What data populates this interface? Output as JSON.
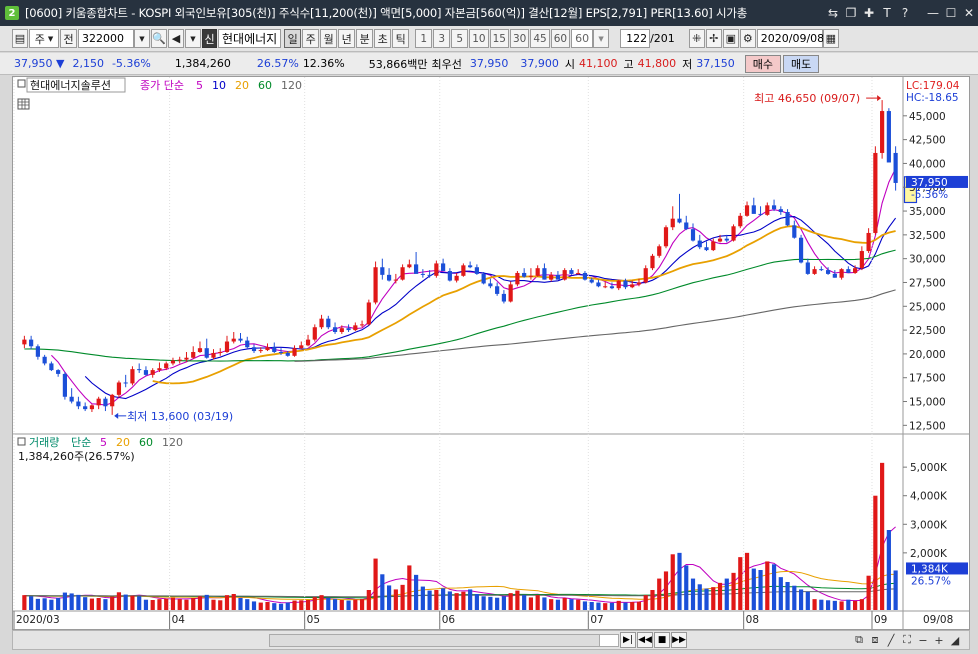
{
  "window": {
    "app_badge": "2",
    "title": "[0600] 키움종합차트 - KOSPI 외국인보유[305(천)] 주식수[11,200(천)] 액면[5,000] 자본금[560(억)] 결산[12월] EPS[2,791] PER[13.60] 시가총"
  },
  "toolbar": {
    "market": "주",
    "prev": "전",
    "code": "322000",
    "new_badge": "신",
    "stock_name": "현대에너지",
    "periods": [
      "일",
      "주",
      "월",
      "년",
      "분",
      "초",
      "틱"
    ],
    "active_period": "일",
    "intervals": [
      "1",
      "3",
      "5",
      "10",
      "15",
      "30",
      "45",
      "60"
    ],
    "interval_value": "60",
    "count": "122",
    "count_total": "/201",
    "date": "2020/09/08"
  },
  "quote": {
    "price": "37,950 ▼",
    "change": "2,150",
    "change_pct": "-5.36%",
    "volume": "1,384,260",
    "volume_ratio": "26.57%",
    "turnover": "12.36%",
    "amount": "53,866백만",
    "best_ask_label": "최우선",
    "best_ask": "37,950",
    "best_bid": "37,900",
    "open_label": "시",
    "open": "41,100",
    "high_label": "고",
    "high": "41,800",
    "low_label": "저",
    "low": "37,150",
    "buy": "매수",
    "sell": "매도"
  },
  "price_pane": {
    "stock_label": "현대에너지솔루션",
    "legend_label": "종가 단순",
    "ma": [
      {
        "period": "5",
        "color": "#c000c0"
      },
      {
        "period": "10",
        "color": "#0000c8"
      },
      {
        "period": "20",
        "color": "#e8a000"
      },
      {
        "period": "60",
        "color": "#008a2a"
      },
      {
        "period": "120",
        "color": "#666666"
      }
    ],
    "lc": "LC:179.04",
    "hc": "HC:-18.65",
    "y_ticks": [
      "45,000",
      "42,500",
      "40,000",
      "37,500",
      "35,000",
      "32,500",
      "30,000",
      "27,500",
      "25,000",
      "22,500",
      "20,000",
      "17,500",
      "15,000",
      "12,500"
    ],
    "current_price": "37,950",
    "current_pct": "-5.36%",
    "high_note": "최고 46,650 (09/07)",
    "low_note": "최저 13,600 (03/19)"
  },
  "volume_pane": {
    "legend_label": "거래량",
    "legend_sub": "단순",
    "ma": [
      {
        "period": "5",
        "color": "#c000c0"
      },
      {
        "period": "20",
        "color": "#e8a000"
      },
      {
        "period": "60",
        "color": "#008a2a"
      },
      {
        "period": "120",
        "color": "#666666"
      }
    ],
    "current_volume": "1,384,260주(26.57%)",
    "y_ticks": [
      "5,000K",
      "4,000K",
      "3,000K",
      "2,000K"
    ],
    "current_badge": "1,384K",
    "current_pct": "26.57%"
  },
  "x_axis": {
    "labels": [
      "2020/03",
      "04",
      "05",
      "06",
      "07",
      "08",
      "09"
    ],
    "right_label": "09/08"
  },
  "colors": {
    "up": "#e01818",
    "down": "#1b4fd8"
  },
  "chart_data": {
    "type": "candlestick",
    "x": [
      "03/02",
      "03/03",
      "03/04",
      "03/05",
      "03/06",
      "03/09",
      "03/10",
      "03/11",
      "03/12",
      "03/13",
      "03/16",
      "03/17",
      "03/18",
      "03/19",
      "03/20",
      "03/23",
      "03/24",
      "03/25",
      "03/26",
      "03/27",
      "03/30",
      "03/31",
      "04/01",
      "04/02",
      "04/03",
      "04/06",
      "04/07",
      "04/08",
      "04/09",
      "04/10",
      "04/13",
      "04/14",
      "04/16",
      "04/17",
      "04/20",
      "04/21",
      "04/22",
      "04/23",
      "04/24",
      "04/27",
      "04/28",
      "04/29",
      "05/04",
      "05/06",
      "05/07",
      "05/08",
      "05/11",
      "05/12",
      "05/13",
      "05/14",
      "05/15",
      "05/18",
      "05/19",
      "05/20",
      "05/21",
      "05/22",
      "05/25",
      "05/26",
      "05/27",
      "05/28",
      "05/29",
      "06/01",
      "06/02",
      "06/03",
      "06/04",
      "06/05",
      "06/08",
      "06/09",
      "06/10",
      "06/11",
      "06/12",
      "06/15",
      "06/16",
      "06/17",
      "06/18",
      "06/19",
      "06/22",
      "06/23",
      "06/24",
      "06/25",
      "06/26",
      "06/29",
      "06/30",
      "07/01",
      "07/02",
      "07/03",
      "07/06",
      "07/07",
      "07/08",
      "07/09",
      "07/10",
      "07/13",
      "07/14",
      "07/15",
      "07/16",
      "07/17",
      "07/20",
      "07/21",
      "07/22",
      "07/23",
      "07/24",
      "07/27",
      "07/28",
      "07/29",
      "07/30",
      "07/31",
      "08/03",
      "08/04",
      "08/05",
      "08/06",
      "08/07",
      "08/10",
      "08/11",
      "08/12",
      "08/13",
      "08/14",
      "08/18",
      "08/19",
      "08/20",
      "08/21",
      "08/24",
      "08/25",
      "08/26",
      "08/27",
      "08/28",
      "08/31",
      "09/01",
      "09/02",
      "09/03",
      "09/04",
      "09/07",
      "09/08"
    ],
    "open": [
      21000,
      21500,
      20800,
      19700,
      19000,
      18300,
      17900,
      15500,
      15000,
      14500,
      14200,
      14600,
      15300,
      14500,
      15700,
      17000,
      16900,
      18400,
      18300,
      17800,
      18300,
      18500,
      19000,
      19300,
      19400,
      19600,
      20200,
      20600,
      19600,
      20100,
      20200,
      21300,
      21600,
      21400,
      20700,
      20300,
      20400,
      20700,
      20200,
      20100,
      19800,
      20600,
      20900,
      21500,
      22800,
      23700,
      22800,
      22300,
      22700,
      22500,
      23000,
      23100,
      25400,
      29100,
      28300,
      27700,
      27800,
      29100,
      29400,
      28400,
      28300,
      28200,
      29500,
      28700,
      27700,
      28200,
      29300,
      29100,
      28400,
      27400,
      27100,
      26300,
      25500,
      27300,
      28500,
      28100,
      28200,
      29000,
      27800,
      28300,
      27800,
      28800,
      28400,
      28500,
      27800,
      27500,
      27100,
      27100,
      26900,
      27700,
      27000,
      27300,
      27500,
      29000,
      30300,
      31300,
      33300,
      34200,
      33800,
      33100,
      31900,
      31200,
      30900,
      31800,
      32100,
      31900,
      33400,
      34500,
      35600,
      34700,
      34600,
      35600,
      35200,
      34900,
      33500,
      32200,
      29600,
      28400,
      28900,
      28800,
      28400,
      28000,
      28900,
      28500,
      29000,
      30800,
      32700,
      41100,
      45500,
      41100
    ],
    "high": [
      21900,
      21900,
      21000,
      19900,
      19200,
      18400,
      18100,
      16400,
      15500,
      14900,
      14700,
      15500,
      15500,
      15800,
      17200,
      17800,
      18700,
      19000,
      18700,
      18500,
      19100,
      19200,
      19600,
      19700,
      20200,
      20800,
      21300,
      21600,
      20500,
      20600,
      21900,
      22300,
      22200,
      21800,
      21000,
      20700,
      21100,
      21200,
      20600,
      20300,
      20900,
      21300,
      22000,
      23100,
      24100,
      24000,
      23300,
      23000,
      23100,
      23300,
      23500,
      25700,
      29700,
      30000,
      29000,
      28400,
      29400,
      29900,
      30700,
      28900,
      28800,
      29800,
      30000,
      29000,
      28500,
      29500,
      29700,
      29400,
      28600,
      27900,
      27500,
      26700,
      27600,
      28700,
      29000,
      29000,
      29300,
      29500,
      28600,
      28700,
      29000,
      29000,
      28900,
      28700,
      28000,
      27800,
      27600,
      27500,
      27800,
      27900,
      27700,
      27900,
      29300,
      30500,
      31500,
      33500,
      35500,
      36800,
      34500,
      33700,
      32500,
      31800,
      32100,
      32500,
      32500,
      33600,
      34800,
      36000,
      36400,
      35500,
      35900,
      36200,
      35500,
      35200,
      34000,
      32500,
      30000,
      29200,
      29200,
      29100,
      28800,
      29000,
      29200,
      29300,
      31300,
      33200,
      41800,
      46650,
      45800,
      41800
    ],
    "low": [
      20600,
      20500,
      19400,
      18800,
      18200,
      17600,
      15200,
      14800,
      14200,
      14000,
      13900,
      14200,
      14000,
      13600,
      15400,
      16500,
      16700,
      18000,
      17700,
      17500,
      18100,
      18300,
      18800,
      19000,
      19200,
      19500,
      20100,
      19500,
      19400,
      19800,
      20100,
      21100,
      21200,
      20600,
      20100,
      20100,
      20300,
      20100,
      19900,
      19700,
      19700,
      20500,
      20800,
      21300,
      22600,
      22600,
      22100,
      22100,
      22300,
      22400,
      22800,
      23000,
      25200,
      27800,
      27600,
      27400,
      27700,
      29000,
      28500,
      28000,
      28000,
      28000,
      28700,
      27600,
      27500,
      28100,
      29000,
      28300,
      27300,
      26900,
      26100,
      25300,
      25400,
      27100,
      28000,
      27800,
      28100,
      27800,
      27600,
      27800,
      27700,
      28300,
      28300,
      27700,
      27400,
      27000,
      26900,
      26800,
      26700,
      26800,
      26900,
      27100,
      27400,
      28800,
      30100,
      31100,
      33000,
      33700,
      33000,
      31800,
      31000,
      30800,
      30800,
      31700,
      31700,
      31800,
      33200,
      34400,
      34800,
      34500,
      34500,
      35000,
      34600,
      33400,
      32100,
      29500,
      28300,
      28300,
      28700,
      28300,
      28000,
      27800,
      28700,
      28400,
      28800,
      30600,
      32500,
      40500,
      41000,
      37150
    ],
    "close": [
      21500,
      20800,
      19700,
      19000,
      18300,
      17900,
      15500,
      15000,
      14500,
      14200,
      14600,
      15300,
      14500,
      15700,
      17000,
      16900,
      18400,
      18300,
      17800,
      18300,
      18500,
      19000,
      19300,
      19400,
      19600,
      20200,
      20600,
      19600,
      20100,
      20200,
      21300,
      21600,
      21400,
      20700,
      20300,
      20400,
      20700,
      20200,
      20100,
      19800,
      20600,
      20900,
      21500,
      22800,
      23700,
      22800,
      22300,
      22700,
      22500,
      23000,
      23100,
      25400,
      29100,
      28300,
      27700,
      27800,
      29100,
      29400,
      28400,
      28300,
      28200,
      29500,
      28700,
      27700,
      28200,
      29300,
      29100,
      28400,
      27400,
      27100,
      26300,
      25500,
      27300,
      28500,
      28100,
      28200,
      29000,
      27800,
      28300,
      27800,
      28800,
      28400,
      28500,
      27800,
      27500,
      27100,
      27100,
      26900,
      27700,
      27000,
      27300,
      27500,
      29000,
      30300,
      31300,
      33300,
      34200,
      33800,
      33100,
      31900,
      31200,
      30900,
      31800,
      32100,
      31900,
      33400,
      34500,
      35600,
      34700,
      34600,
      35600,
      35200,
      34900,
      33500,
      32200,
      29600,
      28400,
      28900,
      28800,
      28400,
      28000,
      28900,
      28500,
      29000,
      30800,
      32700,
      41100,
      45500,
      40100,
      37950
    ],
    "volume": [
      520,
      480,
      390,
      410,
      360,
      420,
      610,
      580,
      530,
      450,
      400,
      420,
      380,
      470,
      620,
      540,
      500,
      480,
      360,
      350,
      380,
      400,
      430,
      380,
      360,
      420,
      480,
      530,
      360,
      340,
      520,
      560,
      420,
      380,
      300,
      260,
      280,
      240,
      220,
      260,
      330,
      340,
      350,
      450,
      520,
      430,
      380,
      350,
      330,
      360,
      380,
      700,
      1800,
      1250,
      860,
      720,
      880,
      1560,
      1230,
      820,
      680,
      700,
      760,
      650,
      590,
      640,
      720,
      560,
      480,
      460,
      430,
      480,
      590,
      680,
      520,
      440,
      520,
      440,
      380,
      360,
      420,
      380,
      360,
      300,
      280,
      260,
      240,
      250,
      320,
      260,
      280,
      290,
      520,
      700,
      1100,
      1350,
      1950,
      2000,
      1560,
      1100,
      900,
      750,
      800,
      950,
      1100,
      1300,
      1850,
      2000,
      1450,
      1400,
      1700,
      1600,
      1150,
      980,
      850,
      720,
      640,
      380,
      360,
      340,
      320,
      300,
      360,
      320,
      380,
      1200,
      4000,
      5150,
      2800,
      1384
    ]
  }
}
